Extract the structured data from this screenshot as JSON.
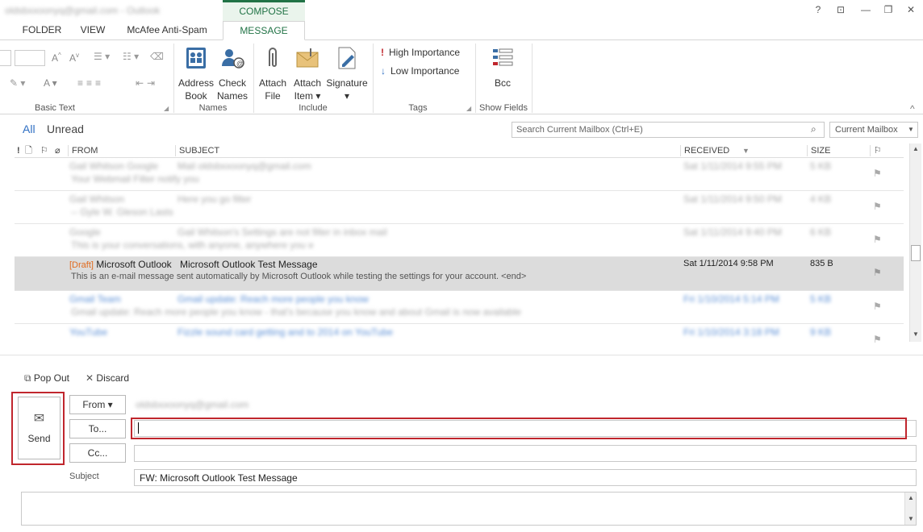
{
  "window": {
    "title_blurred": "oldsbxxoonyq@gmail.com - Outlook",
    "compose_tools": "COMPOSE TOOLS",
    "controls": {
      "help": "?",
      "restore_ribbon": "⊡",
      "minimize": "—",
      "maximize": "❐",
      "close": "✕"
    }
  },
  "tabs": [
    {
      "label": "FOLDER"
    },
    {
      "label": "VIEW"
    },
    {
      "label": "McAfee Anti-Spam"
    },
    {
      "label": "MESSAGE"
    }
  ],
  "ribbon": {
    "basic_text_label": "Basic Text",
    "names_label": "Names",
    "include_label": "Include",
    "tags_label": "Tags",
    "show_fields_label": "Show Fields",
    "address_book": {
      "line1": "Address",
      "line2": "Book"
    },
    "check_names": {
      "line1": "Check",
      "line2": "Names"
    },
    "attach_file": {
      "line1": "Attach",
      "line2": "File"
    },
    "attach_item": {
      "line1": "Attach",
      "line2": "Item ▾"
    },
    "signature": {
      "line1": "Signature",
      "line2": "▾"
    },
    "high_importance": "High Importance",
    "low_importance": "Low Importance",
    "bcc": "Bcc"
  },
  "mailbox": {
    "filter_all": "All",
    "filter_unread": "Unread",
    "search_placeholder": "Search Current Mailbox (Ctrl+E)",
    "scope": "Current Mailbox",
    "columns": {
      "from": "FROM",
      "subject": "SUBJECT",
      "received": "RECEIVED",
      "size": "SIZE"
    },
    "draft": {
      "tag": "[Draft]",
      "from": "Microsoft Outlook",
      "subject": "Microsoft Outlook Test Message",
      "preview": "This is an e-mail message sent automatically by Microsoft Outlook while testing the settings for your account.  <end>",
      "received": "Sat 1/11/2014 9:58 PM",
      "size": "835 B"
    },
    "blurred_rows": [
      {
        "from": "Gail Whitson Google",
        "subject": "Mail oldsbxxoonyq@gmail.com",
        "preview": "Your Webmail Filter notify you",
        "received": "Sat 1/11/2014 9:55 PM",
        "size": "5 KB"
      },
      {
        "from": "Gail Whitson",
        "subject": "Here you go filter",
        "preview": "-- Gyle W. Gleson Lasts",
        "received": "Sat 1/11/2014 9:50 PM",
        "size": "4 KB"
      },
      {
        "from": "Google",
        "subject": "Gail Whitson's Settings are not filter in inbox mail",
        "preview": "This is your conversations, with anyone, anywhere you want",
        "received": "Sat 1/11/2014 9:40 PM",
        "size": "6 KB"
      },
      {
        "from": "Gmail Team",
        "subject": "Gmail update: Reach more people you know",
        "preview": "Gmail update: Reach more people you know - that's because you know and about Gmail is now available",
        "received": "Fri 1/10/2014 5:14 PM",
        "size": "5 KB"
      },
      {
        "from": "YouTube",
        "subject": "Fizzle sound card getting and to 2014 on YouTube",
        "preview": "",
        "received": "Fri 1/10/2014 3:18 PM",
        "size": "9 KB"
      }
    ]
  },
  "compose": {
    "pop_out": "Pop Out",
    "discard": "Discard",
    "send": "Send",
    "from_button": "From ▾",
    "from_value_blurred": "oldsbxxoonyq@gmail.com",
    "to_button": "To...",
    "to_value": "",
    "cc_button": "Cc...",
    "cc_value": "",
    "subject_label": "Subject",
    "subject_value": "FW: Microsoft Outlook Test Message"
  },
  "colors": {
    "accent_green": "#217346",
    "highlight_red": "#c0262d",
    "draft_orange": "#e06b1f",
    "selected_row": "#dcdcdc"
  }
}
